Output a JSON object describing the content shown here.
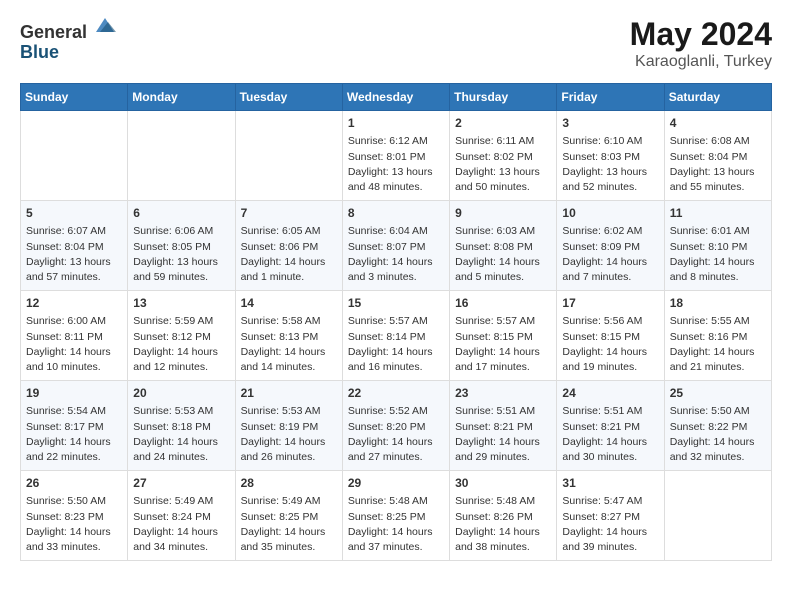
{
  "header": {
    "logo_general": "General",
    "logo_blue": "Blue",
    "month": "May 2024",
    "location": "Karaoglanli, Turkey"
  },
  "weekdays": [
    "Sunday",
    "Monday",
    "Tuesday",
    "Wednesday",
    "Thursday",
    "Friday",
    "Saturday"
  ],
  "weeks": [
    [
      {
        "day": "",
        "info": ""
      },
      {
        "day": "",
        "info": ""
      },
      {
        "day": "",
        "info": ""
      },
      {
        "day": "1",
        "info": "Sunrise: 6:12 AM\nSunset: 8:01 PM\nDaylight: 13 hours\nand 48 minutes."
      },
      {
        "day": "2",
        "info": "Sunrise: 6:11 AM\nSunset: 8:02 PM\nDaylight: 13 hours\nand 50 minutes."
      },
      {
        "day": "3",
        "info": "Sunrise: 6:10 AM\nSunset: 8:03 PM\nDaylight: 13 hours\nand 52 minutes."
      },
      {
        "day": "4",
        "info": "Sunrise: 6:08 AM\nSunset: 8:04 PM\nDaylight: 13 hours\nand 55 minutes."
      }
    ],
    [
      {
        "day": "5",
        "info": "Sunrise: 6:07 AM\nSunset: 8:04 PM\nDaylight: 13 hours\nand 57 minutes."
      },
      {
        "day": "6",
        "info": "Sunrise: 6:06 AM\nSunset: 8:05 PM\nDaylight: 13 hours\nand 59 minutes."
      },
      {
        "day": "7",
        "info": "Sunrise: 6:05 AM\nSunset: 8:06 PM\nDaylight: 14 hours\nand 1 minute."
      },
      {
        "day": "8",
        "info": "Sunrise: 6:04 AM\nSunset: 8:07 PM\nDaylight: 14 hours\nand 3 minutes."
      },
      {
        "day": "9",
        "info": "Sunrise: 6:03 AM\nSunset: 8:08 PM\nDaylight: 14 hours\nand 5 minutes."
      },
      {
        "day": "10",
        "info": "Sunrise: 6:02 AM\nSunset: 8:09 PM\nDaylight: 14 hours\nand 7 minutes."
      },
      {
        "day": "11",
        "info": "Sunrise: 6:01 AM\nSunset: 8:10 PM\nDaylight: 14 hours\nand 8 minutes."
      }
    ],
    [
      {
        "day": "12",
        "info": "Sunrise: 6:00 AM\nSunset: 8:11 PM\nDaylight: 14 hours\nand 10 minutes."
      },
      {
        "day": "13",
        "info": "Sunrise: 5:59 AM\nSunset: 8:12 PM\nDaylight: 14 hours\nand 12 minutes."
      },
      {
        "day": "14",
        "info": "Sunrise: 5:58 AM\nSunset: 8:13 PM\nDaylight: 14 hours\nand 14 minutes."
      },
      {
        "day": "15",
        "info": "Sunrise: 5:57 AM\nSunset: 8:14 PM\nDaylight: 14 hours\nand 16 minutes."
      },
      {
        "day": "16",
        "info": "Sunrise: 5:57 AM\nSunset: 8:15 PM\nDaylight: 14 hours\nand 17 minutes."
      },
      {
        "day": "17",
        "info": "Sunrise: 5:56 AM\nSunset: 8:15 PM\nDaylight: 14 hours\nand 19 minutes."
      },
      {
        "day": "18",
        "info": "Sunrise: 5:55 AM\nSunset: 8:16 PM\nDaylight: 14 hours\nand 21 minutes."
      }
    ],
    [
      {
        "day": "19",
        "info": "Sunrise: 5:54 AM\nSunset: 8:17 PM\nDaylight: 14 hours\nand 22 minutes."
      },
      {
        "day": "20",
        "info": "Sunrise: 5:53 AM\nSunset: 8:18 PM\nDaylight: 14 hours\nand 24 minutes."
      },
      {
        "day": "21",
        "info": "Sunrise: 5:53 AM\nSunset: 8:19 PM\nDaylight: 14 hours\nand 26 minutes."
      },
      {
        "day": "22",
        "info": "Sunrise: 5:52 AM\nSunset: 8:20 PM\nDaylight: 14 hours\nand 27 minutes."
      },
      {
        "day": "23",
        "info": "Sunrise: 5:51 AM\nSunset: 8:21 PM\nDaylight: 14 hours\nand 29 minutes."
      },
      {
        "day": "24",
        "info": "Sunrise: 5:51 AM\nSunset: 8:21 PM\nDaylight: 14 hours\nand 30 minutes."
      },
      {
        "day": "25",
        "info": "Sunrise: 5:50 AM\nSunset: 8:22 PM\nDaylight: 14 hours\nand 32 minutes."
      }
    ],
    [
      {
        "day": "26",
        "info": "Sunrise: 5:50 AM\nSunset: 8:23 PM\nDaylight: 14 hours\nand 33 minutes."
      },
      {
        "day": "27",
        "info": "Sunrise: 5:49 AM\nSunset: 8:24 PM\nDaylight: 14 hours\nand 34 minutes."
      },
      {
        "day": "28",
        "info": "Sunrise: 5:49 AM\nSunset: 8:25 PM\nDaylight: 14 hours\nand 35 minutes."
      },
      {
        "day": "29",
        "info": "Sunrise: 5:48 AM\nSunset: 8:25 PM\nDaylight: 14 hours\nand 37 minutes."
      },
      {
        "day": "30",
        "info": "Sunrise: 5:48 AM\nSunset: 8:26 PM\nDaylight: 14 hours\nand 38 minutes."
      },
      {
        "day": "31",
        "info": "Sunrise: 5:47 AM\nSunset: 8:27 PM\nDaylight: 14 hours\nand 39 minutes."
      },
      {
        "day": "",
        "info": ""
      }
    ]
  ]
}
